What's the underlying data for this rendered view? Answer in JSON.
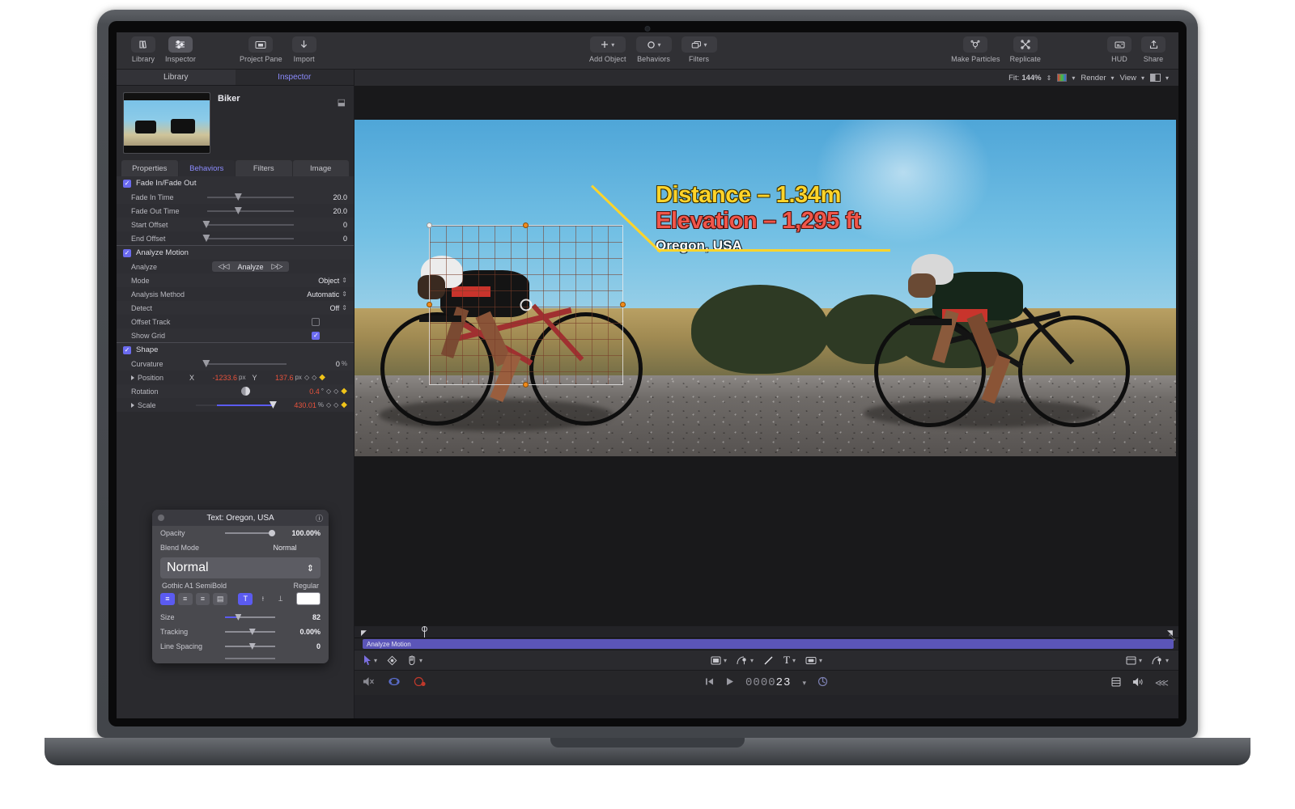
{
  "app": {
    "toolbar": {
      "left_buttons": [
        {
          "label": "Library",
          "icon": "library-icon",
          "active": false
        },
        {
          "label": "Inspector",
          "icon": "inspector-icon",
          "active": true
        }
      ],
      "mid_buttons": [
        {
          "label": "Project Pane",
          "icon": "project-pane-icon"
        },
        {
          "label": "Import",
          "icon": "import-down-arrow-icon"
        }
      ],
      "center_buttons": [
        {
          "label": "Add Object",
          "icon": "plus-icon"
        },
        {
          "label": "Behaviors",
          "icon": "behaviors-circle-icon"
        },
        {
          "label": "Filters",
          "icon": "filters-stack-icon"
        }
      ],
      "right_buttons": [
        {
          "label": "Make Particles",
          "icon": "particles-icon"
        },
        {
          "label": "Replicate",
          "icon": "replicate-icon"
        },
        {
          "label": "HUD",
          "icon": "hud-icon"
        },
        {
          "label": "Share",
          "icon": "share-icon"
        }
      ]
    },
    "canvas_topbar": {
      "fit_label": "Fit:",
      "fit_value": "144%",
      "render_label": "Render",
      "view_label": "View"
    }
  },
  "left_panel": {
    "pane_tabs": [
      {
        "label": "Library",
        "selected": false
      },
      {
        "label": "Inspector",
        "selected": true
      }
    ],
    "asset": {
      "title": "Biker",
      "lock_icon": "lock-icon"
    },
    "inspector_tabs": [
      {
        "label": "Properties",
        "selected": false
      },
      {
        "label": "Behaviors",
        "selected": true
      },
      {
        "label": "Filters",
        "selected": false
      },
      {
        "label": "Image",
        "selected": false
      }
    ],
    "groups": [
      {
        "name": "Fade In/Fade Out",
        "enabled": true,
        "rows": [
          {
            "label": "Fade In Time",
            "value": "20.0",
            "unit": "",
            "knob": 34
          },
          {
            "label": "Fade Out Time",
            "value": "20.0",
            "unit": "",
            "knob": 34
          },
          {
            "label": "Start Offset",
            "value": "0",
            "unit": "",
            "knob": 2
          },
          {
            "label": "End Offset",
            "value": "0",
            "unit": "",
            "knob": 2
          }
        ]
      },
      {
        "name": "Analyze Motion",
        "enabled": true,
        "analyze_row": {
          "label": "Analyze",
          "prev_icon": "rewind-icon",
          "button_label": "Analyze",
          "next_icon": "forward-icon"
        },
        "rows": [
          {
            "label": "Mode",
            "value": "Object",
            "type": "select"
          },
          {
            "label": "Analysis Method",
            "value": "Automatic",
            "type": "select"
          },
          {
            "label": "Detect",
            "value": "Off",
            "type": "select"
          },
          {
            "label": "Offset Track",
            "value": "",
            "type": "checkbox",
            "checked": false
          },
          {
            "label": "Show Grid",
            "value": "",
            "type": "checkbox",
            "checked": true
          }
        ]
      },
      {
        "name": "Shape",
        "enabled": true,
        "rows": [
          {
            "label": "Curvature",
            "value": "0",
            "unit": "%",
            "knob": 2,
            "type": "slider"
          },
          {
            "label": "Position",
            "x_axis": "X",
            "x_value": "-1233.6",
            "x_unit": "px",
            "y_axis": "Y",
            "y_value": "137.6",
            "y_unit": "px",
            "type": "xy",
            "disclosure": true
          },
          {
            "label": "Rotation",
            "value": "0.4",
            "unit": "°",
            "type": "dial"
          },
          {
            "label": "Scale",
            "value": "430.01",
            "unit": "%",
            "type": "slider-bar",
            "disclosure": true
          }
        ]
      }
    ]
  },
  "hud": {
    "title": "Text: Oregon, USA",
    "info_icon": "info-icon",
    "close_icon": "close-icon",
    "rows": [
      {
        "label": "Opacity",
        "value": "100.00%"
      },
      {
        "label": "Blend Mode",
        "value": "Normal"
      }
    ],
    "blend_select_value": "Normal",
    "font_name": "Gothic A1 SemiBold",
    "font_style": "Regular",
    "align_buttons": [
      {
        "name": "align-left-icon",
        "active": true
      },
      {
        "name": "align-center-icon",
        "active": false
      },
      {
        "name": "align-right-icon",
        "active": false
      },
      {
        "name": "align-justify-icon",
        "active": false
      }
    ],
    "vertical_buttons": [
      {
        "name": "text-top-align-icon",
        "active": true
      },
      {
        "name": "text-middle-align-icon",
        "active": false
      },
      {
        "name": "text-bottom-align-icon",
        "active": false
      }
    ],
    "color_swatch": "#ffffff",
    "sliders": [
      {
        "label": "Size",
        "value": "82"
      },
      {
        "label": "Tracking",
        "value": "0.00%"
      },
      {
        "label": "Line Spacing",
        "value": "0"
      }
    ]
  },
  "canvas": {
    "overlay": {
      "distance": "Distance – 1.34m",
      "elevation": "Elevation – 1,295 ft",
      "location": "Oregon, USA",
      "distance_color": "#ffd42a",
      "elevation_color": "#f0564a",
      "location_color": "#ffffff"
    }
  },
  "timeline": {
    "behavior_track_label": "Analyze Motion",
    "track_color": "#5b55b8",
    "left_tools": [
      {
        "name": "select-arrow-tool",
        "caret": true
      },
      {
        "name": "transform-tool",
        "caret": false
      },
      {
        "name": "pan-hand-tool",
        "caret": true
      }
    ],
    "center_tools": [
      {
        "name": "rectangle-shape-tool",
        "caret": true
      },
      {
        "name": "bezier-pen-tool",
        "caret": true
      },
      {
        "name": "line-tool",
        "caret": false
      },
      {
        "name": "text-tool",
        "caret": true
      },
      {
        "name": "mask-tool",
        "caret": true
      }
    ],
    "right_tools": [
      {
        "name": "view-layout-tool",
        "caret": true
      },
      {
        "name": "curve-tool",
        "caret": true
      }
    ]
  },
  "transport": {
    "timecode": "000023",
    "timecode_dim_prefix": "0000",
    "timecode_bright_suffix": "23",
    "left_icons": [
      {
        "name": "mute-audio-icon"
      },
      {
        "name": "loop-playback-icon"
      },
      {
        "name": "record-keyframe-icon"
      }
    ],
    "center_icons": [
      {
        "name": "go-to-start-icon"
      },
      {
        "name": "play-icon"
      },
      {
        "name": "timecode-dropdown-caret-icon"
      },
      {
        "name": "loop-region-icon"
      }
    ],
    "right_icons": [
      {
        "name": "layers-toggle-icon"
      },
      {
        "name": "volume-icon"
      },
      {
        "name": "collapse-panel-icon"
      }
    ]
  }
}
